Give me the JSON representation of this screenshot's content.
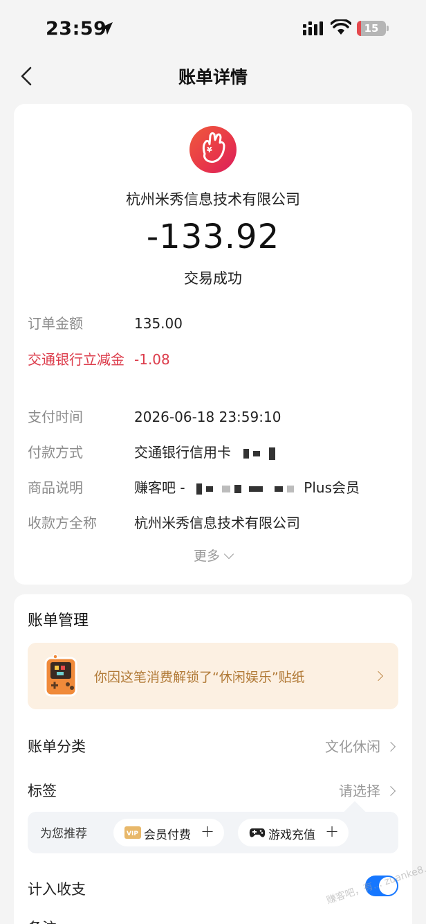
{
  "status_bar": {
    "time": "23:59",
    "battery": "15",
    "battery_level": 0.15,
    "icons": [
      "location-arrow-icon",
      "cellular-signal-icon",
      "wifi-icon",
      "battery-icon"
    ]
  },
  "nav": {
    "title": "账单详情",
    "back_icon": "chevron-left-icon"
  },
  "summary": {
    "merchant_name": "杭州米秀信息技术有限公司",
    "amount": "-133.92",
    "status": "交易成功"
  },
  "details": [
    {
      "label": "订单金额",
      "value": "135.00"
    },
    {
      "label": "交通银行立减金",
      "value": "-1.08"
    },
    {
      "label": "支付时间",
      "value": "2026-06-18 23:59:10"
    },
    {
      "label": "付款方式",
      "value": "交通银行信用卡"
    },
    {
      "label": "商品说明",
      "value_prefix": "赚客吧 -",
      "value_suffix": "Plus会员"
    },
    {
      "label": "收款方全称",
      "value": "杭州米秀信息技术有限公司"
    }
  ],
  "more": "更多",
  "management": {
    "title": "账单管理",
    "sticker_banner": "你因这笔消费解锁了“休闲娱乐”贴纸",
    "category": {
      "label": "账单分类",
      "value": "文化休闲"
    },
    "tags": {
      "label": "标签",
      "value": "请选择"
    },
    "recommend": {
      "label": "为您推荐",
      "chips": [
        {
          "icon": "vip-icon",
          "label": "会员付费",
          "action": "+"
        },
        {
          "icon": "gamepad-icon",
          "label": "游戏充值",
          "action": "+"
        }
      ]
    },
    "income_expense": {
      "label": "计入收支",
      "enabled": true
    },
    "notes": {
      "label": "备注"
    }
  },
  "watermark": "赚客吧，有... zuanke8.com",
  "colors": {
    "accent_blue": "#1677ff",
    "discount_red": "#dc3b4a",
    "banner_bg": "#fcf0e2",
    "banner_text": "#b17a37"
  }
}
